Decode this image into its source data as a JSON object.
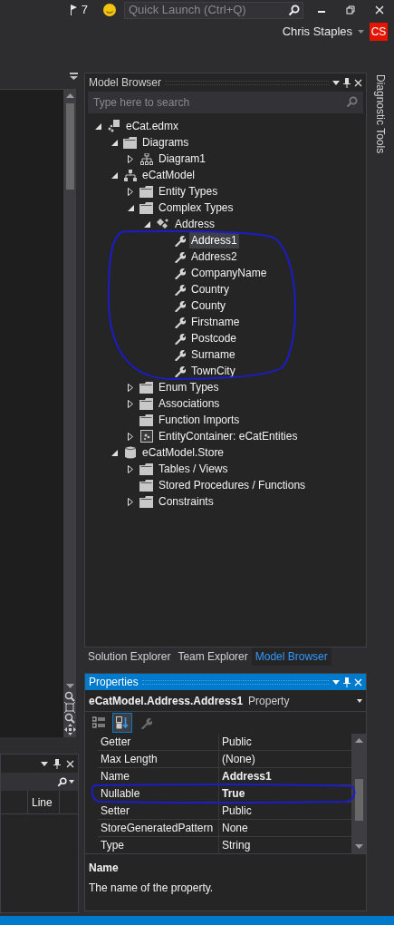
{
  "title_bar": {
    "notification_count": "7",
    "quick_launch": {
      "placeholder": "Quick Launch (Ctrl+Q)"
    }
  },
  "account": {
    "name": "Chris Staples",
    "initials": "CS"
  },
  "model_browser": {
    "title": "Model Browser",
    "search": {
      "placeholder": "Type here to search"
    },
    "tree": [
      {
        "label": "eCat.edmx",
        "kind": "edmx",
        "expanded": true,
        "selected": false,
        "children": [
          {
            "label": "Diagrams",
            "kind": "folder",
            "expanded": true,
            "selected": false,
            "children": [
              {
                "label": "Diagram1",
                "kind": "diagram",
                "expanded": false,
                "selected": false
              }
            ]
          },
          {
            "label": "eCatModel",
            "kind": "model",
            "expanded": true,
            "selected": false,
            "children": [
              {
                "label": "Entity Types",
                "kind": "folder",
                "expanded": false,
                "selected": false
              },
              {
                "label": "Complex Types",
                "kind": "folder",
                "expanded": true,
                "selected": false,
                "children": [
                  {
                    "label": "Address",
                    "kind": "complex",
                    "expanded": true,
                    "selected": false,
                    "children": [
                      {
                        "label": "Address1",
                        "kind": "property",
                        "selected": true
                      },
                      {
                        "label": "Address2",
                        "kind": "property",
                        "selected": false
                      },
                      {
                        "label": "CompanyName",
                        "kind": "property",
                        "selected": false
                      },
                      {
                        "label": "Country",
                        "kind": "property",
                        "selected": false
                      },
                      {
                        "label": "County",
                        "kind": "property",
                        "selected": false
                      },
                      {
                        "label": "Firstname",
                        "kind": "property",
                        "selected": false
                      },
                      {
                        "label": "Postcode",
                        "kind": "property",
                        "selected": false
                      },
                      {
                        "label": "Surname",
                        "kind": "property",
                        "selected": false
                      },
                      {
                        "label": "TownCity",
                        "kind": "property",
                        "selected": false
                      }
                    ]
                  }
                ]
              },
              {
                "label": "Enum Types",
                "kind": "folder",
                "expanded": false,
                "selected": false
              },
              {
                "label": "Associations",
                "kind": "folder",
                "expanded": false,
                "selected": false
              },
              {
                "label": "Function Imports",
                "kind": "folder",
                "selected": false
              },
              {
                "label": "EntityContainer: eCatEntities",
                "kind": "container",
                "expanded": false,
                "selected": false
              }
            ]
          },
          {
            "label": "eCatModel.Store",
            "kind": "database",
            "expanded": true,
            "selected": false,
            "children": [
              {
                "label": "Tables / Views",
                "kind": "folder",
                "expanded": false,
                "selected": false
              },
              {
                "label": "Stored Procedures / Functions",
                "kind": "folder",
                "selected": false
              },
              {
                "label": "Constraints",
                "kind": "folder",
                "expanded": false,
                "selected": false
              }
            ]
          }
        ]
      }
    ]
  },
  "tabs": [
    {
      "label": "Solution Explorer",
      "selected": false
    },
    {
      "label": "Team Explorer",
      "selected": false
    },
    {
      "label": "Model Browser",
      "selected": true
    }
  ],
  "properties": {
    "title": "Properties",
    "object_name": "eCatModel.Address.Address1",
    "object_type": "Property",
    "toolbar": [
      {
        "kind": "categorized",
        "selected": false,
        "disabled": false
      },
      {
        "kind": "alphabetical",
        "selected": true,
        "disabled": false
      },
      {
        "kind": "pages",
        "selected": false,
        "disabled": true
      }
    ],
    "rows": [
      {
        "name": "Getter",
        "value": "Public",
        "modified": false
      },
      {
        "name": "Max Length",
        "value": "(None)",
        "modified": false
      },
      {
        "name": "Name",
        "value": "Address1",
        "modified": true
      },
      {
        "name": "Nullable",
        "value": "True",
        "modified": true
      },
      {
        "name": "Setter",
        "value": "Public",
        "modified": false
      },
      {
        "name": "StoreGeneratedPattern",
        "value": "None",
        "modified": false
      },
      {
        "name": "Type",
        "value": "String",
        "modified": false
      }
    ],
    "description": {
      "title": "Name",
      "text": "The name of the property."
    }
  },
  "bottom_left_panel": {
    "columns": [
      "Line"
    ]
  },
  "side_tab": {
    "label": "Diagnostic Tools"
  }
}
